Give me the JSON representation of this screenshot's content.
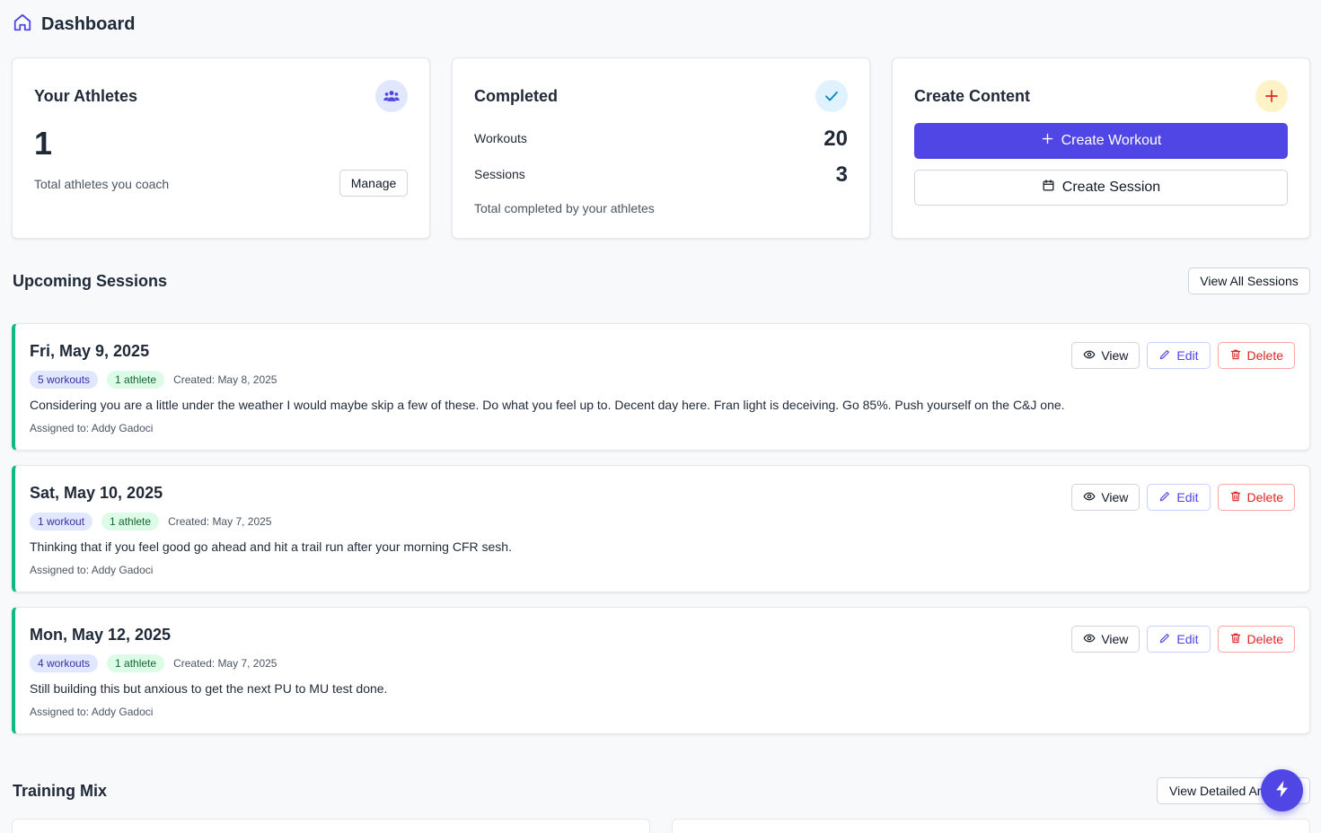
{
  "header": {
    "title": "Dashboard",
    "icon": "home-icon"
  },
  "athletes_card": {
    "title": "Your Athletes",
    "count": "1",
    "subtitle": "Total athletes you coach",
    "manage_label": "Manage",
    "icon": "users-icon"
  },
  "completed_card": {
    "title": "Completed",
    "workouts_label": "Workouts",
    "workouts_value": "20",
    "sessions_label": "Sessions",
    "sessions_value": "3",
    "footnote": "Total completed by your athletes",
    "icon": "check-icon"
  },
  "create_card": {
    "title": "Create Content",
    "create_workout_label": "Create Workout",
    "create_session_label": "Create Session",
    "icon": "plus-icon"
  },
  "upcoming": {
    "title": "Upcoming Sessions",
    "view_all_label": "View All Sessions",
    "sessions": [
      {
        "date": "Fri, May 9, 2025",
        "workouts": "5 workouts",
        "athletes": "1 athlete",
        "created": "Created: May 8, 2025",
        "description": "Considering you are a little under the weather I would maybe skip a few of these. Do what you feel up to. Decent day here. Fran light is deceiving. Go 85%. Push yourself on the C&J one.",
        "assigned": "Assigned to: Addy Gadoci"
      },
      {
        "date": "Sat, May 10, 2025",
        "workouts": "1 workout",
        "athletes": "1 athlete",
        "created": "Created: May 7, 2025",
        "description": "Thinking that if you feel good go ahead and hit a trail run after your morning CFR sesh.",
        "assigned": "Assigned to: Addy Gadoci"
      },
      {
        "date": "Mon, May 12, 2025",
        "workouts": "4 workouts",
        "athletes": "1 athlete",
        "created": "Created: May 7, 2025",
        "description": "Still building this but anxious to get the next PU to MU test done.",
        "assigned": "Assigned to: Addy Gadoci"
      }
    ],
    "actions": {
      "view": "View",
      "edit": "Edit",
      "delete": "Delete"
    }
  },
  "training_mix": {
    "title": "Training Mix",
    "view_detailed_label": "View Detailed Ar"
  },
  "colors": {
    "primary": "#4f46e5",
    "success": "#10b981",
    "danger": "#dc2626"
  }
}
